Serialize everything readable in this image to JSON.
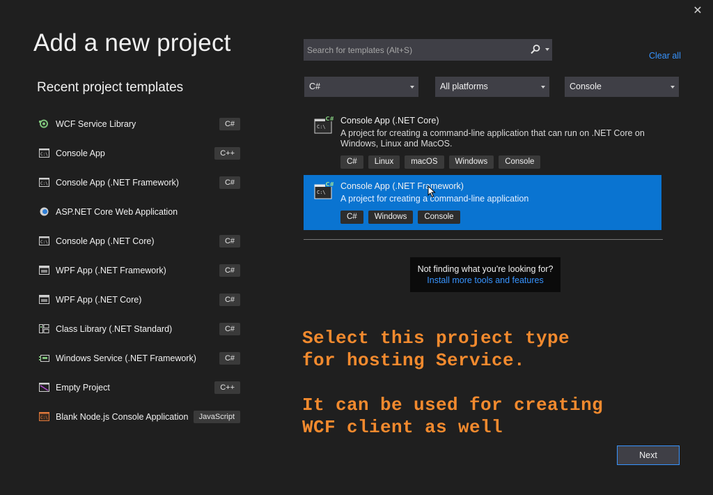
{
  "dialog": {
    "title": "Add a new project",
    "close_label": "✕"
  },
  "recent": {
    "heading": "Recent project templates",
    "items": [
      {
        "label": "WCF Service Library",
        "tag": "C#",
        "icon": "wcf-service-icon"
      },
      {
        "label": "Console App",
        "tag": "C++",
        "icon": "console-icon"
      },
      {
        "label": "Console App (.NET Framework)",
        "tag": "C#",
        "icon": "console-icon"
      },
      {
        "label": "ASP.NET Core Web Application",
        "tag": "",
        "icon": "web-globe-icon"
      },
      {
        "label": "Console App (.NET Core)",
        "tag": "C#",
        "icon": "console-icon"
      },
      {
        "label": "WPF App (.NET Framework)",
        "tag": "C#",
        "icon": "wpf-window-icon"
      },
      {
        "label": "WPF App (.NET Core)",
        "tag": "C#",
        "icon": "wpf-window-icon"
      },
      {
        "label": "Class Library (.NET Standard)",
        "tag": "C#",
        "icon": "class-library-icon"
      },
      {
        "label": "Windows Service (.NET Framework)",
        "tag": "C#",
        "icon": "windows-service-icon"
      },
      {
        "label": "Empty Project",
        "tag": "C++",
        "icon": "empty-project-icon"
      },
      {
        "label": "Blank Node.js Console Application",
        "tag": "JavaScript",
        "icon": "nodejs-console-icon"
      }
    ]
  },
  "search": {
    "placeholder": "Search for templates (Alt+S)",
    "value": ""
  },
  "clear_all": "Clear all",
  "filters": {
    "language": "C#",
    "platform": "All platforms",
    "project_type": "Console"
  },
  "templates": [
    {
      "title": "Console App (.NET Core)",
      "description": "A project for creating a command-line application that can run on .NET Core on Windows, Linux and MacOS.",
      "tags": [
        "C#",
        "Linux",
        "macOS",
        "Windows",
        "Console"
      ],
      "selected": false
    },
    {
      "title": "Console App (.NET Framework)",
      "description": "A project for creating a command-line application",
      "tags": [
        "C#",
        "Windows",
        "Console"
      ],
      "selected": true
    }
  ],
  "hint": {
    "text": "Not finding what you're looking for?",
    "link": "Install more tools and features"
  },
  "annotation": {
    "line1": "Select this project type",
    "line2": "for hosting Service.",
    "line3": "It can be used for creating",
    "line4": "WCF client as well"
  },
  "next_label": "Next",
  "colors": {
    "background": "#1f1f1f",
    "selected": "#0a74d1",
    "link": "#3794ff",
    "annotation": "#f28a2e"
  }
}
